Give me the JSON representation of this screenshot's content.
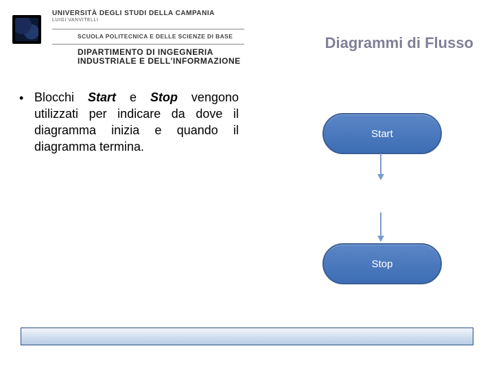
{
  "header": {
    "university_line": "UNIVERSITÀ DEGLI STUDI DELLA CAMPANIA",
    "university_sub": "LUIGI VANVITELLI",
    "school_line": "SCUOLA POLITECNICA E DELLE SCIENZE DI BASE",
    "dept_line1": "DIPARTIMENTO DI INGEGNERIA",
    "dept_line2": "INDUSTRIALE E DELL'INFORMAZIONE"
  },
  "title": "Diagrammi di Flusso",
  "bullet": {
    "pre": "Blocchi ",
    "word1": "Start",
    "mid1": " e ",
    "word2": "Stop",
    "rest": " vengono utilizzati per indicare da dove il diagramma inizia e quando il diagramma termina."
  },
  "diagram": {
    "start_label": "Start",
    "stop_label": "Stop"
  },
  "footer": {
    "left": "",
    "right": ""
  }
}
